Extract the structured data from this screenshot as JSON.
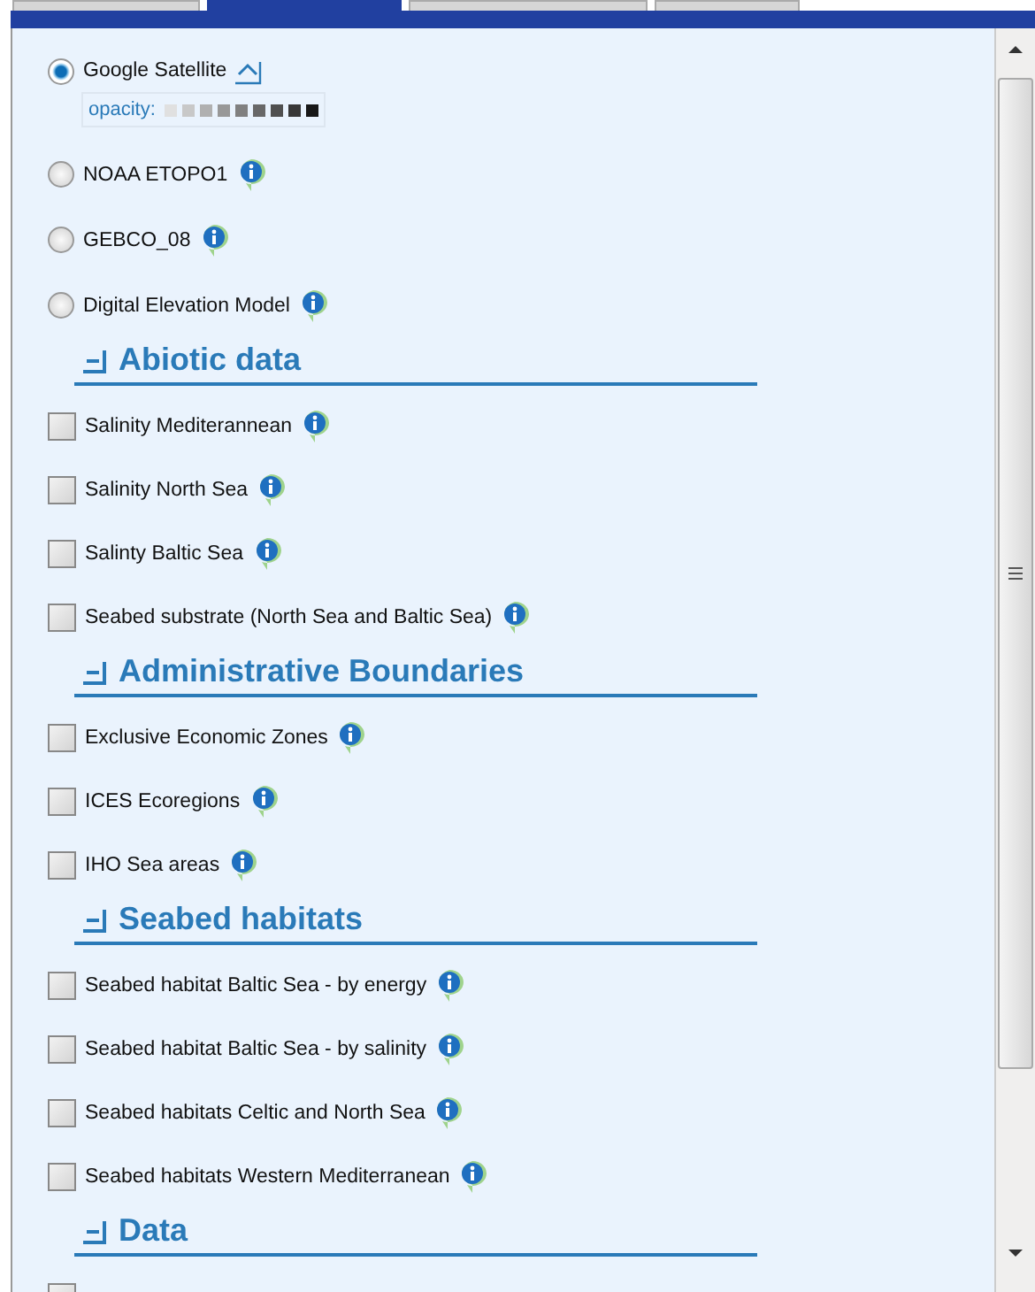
{
  "tabs": [
    {
      "selected": false
    },
    {
      "selected": true
    },
    {
      "selected": false
    },
    {
      "selected": false
    }
  ],
  "base_layers": [
    {
      "label": "Google Satellite",
      "kind": "expandable",
      "selected": true,
      "opacity_label": "opacity:"
    },
    {
      "label": "NOAA ETOPO1",
      "kind": "info",
      "selected": false
    },
    {
      "label": "GEBCO_08",
      "kind": "info",
      "selected": false
    },
    {
      "label": "Digital Elevation Model",
      "kind": "info",
      "selected": false
    }
  ],
  "groups": [
    {
      "title": "Abiotic data",
      "expanded": true,
      "layers": [
        {
          "label": "Salinity Mediterannean",
          "checked": false
        },
        {
          "label": "Salinity North Sea",
          "checked": false
        },
        {
          "label": "Salinty Baltic Sea",
          "checked": false
        },
        {
          "label": "Seabed substrate (North Sea and Baltic Sea)",
          "checked": false
        }
      ]
    },
    {
      "title": "Administrative Boundaries",
      "expanded": true,
      "layers": [
        {
          "label": "Exclusive Economic Zones",
          "checked": false
        },
        {
          "label": "ICES Ecoregions",
          "checked": false
        },
        {
          "label": "IHO Sea areas",
          "checked": false
        }
      ]
    },
    {
      "title": "Seabed habitats",
      "expanded": true,
      "layers": [
        {
          "label": "Seabed habitat Baltic Sea - by energy",
          "checked": false
        },
        {
          "label": "Seabed habitat Baltic Sea - by salinity",
          "checked": false
        },
        {
          "label": "Seabed habitats Celtic and North Sea",
          "checked": false
        },
        {
          "label": "Seabed habitats Western Mediterranean",
          "checked": false
        }
      ]
    },
    {
      "title": "Data",
      "expanded": true,
      "layers": [
        {
          "checked": false
        }
      ]
    }
  ]
}
